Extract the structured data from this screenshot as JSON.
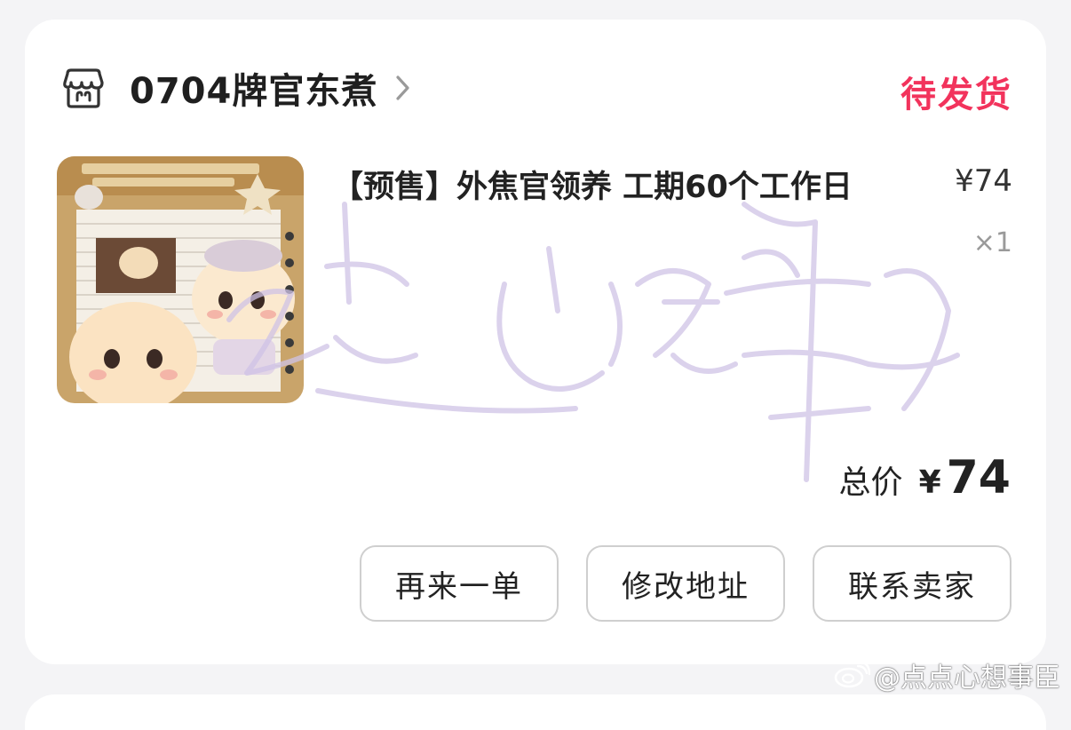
{
  "order": {
    "shop_name": "0704牌官东煮",
    "status": "待发货",
    "status_color": "#f2335c"
  },
  "product": {
    "title": "【预售】外焦官领养 工期60个工作日",
    "unit_price": "¥74",
    "quantity": "×1",
    "image_description_icon": "plush-bear-product-image"
  },
  "summary": {
    "total_label": "总价",
    "total_currency": "¥",
    "total_amount": "74"
  },
  "actions": {
    "reorder_label": "再来一单",
    "edit_address_label": "修改地址",
    "contact_seller_label": "联系卖家"
  },
  "watermark": {
    "weibo_text": "@点点心想事臣"
  }
}
